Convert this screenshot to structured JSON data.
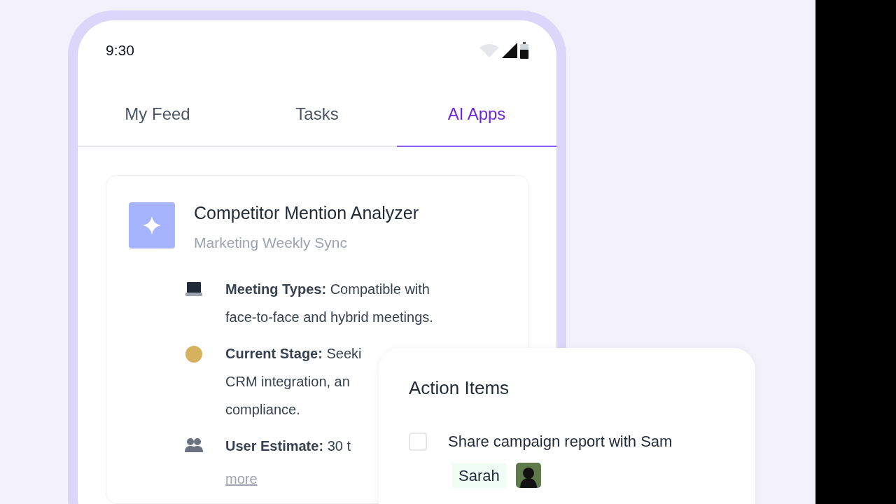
{
  "status_bar": {
    "time": "9:30"
  },
  "tabs": [
    {
      "label": "My Feed",
      "selected": false
    },
    {
      "label": "Tasks",
      "selected": false
    },
    {
      "label": "AI Apps",
      "selected": true
    }
  ],
  "app_card": {
    "title": "Competitor Mention Analyzer",
    "subtitle": "Marketing Weekly Sync",
    "details": [
      {
        "kind": "laptop",
        "label": "Meeting Types:",
        "lines": [
          "Compatible with",
          "face-to-face and hybrid meetings."
        ]
      },
      {
        "kind": "emoji",
        "label": "Current Stage:",
        "lines": [
          "Seeki",
          "CRM integration, an",
          "compliance."
        ]
      },
      {
        "kind": "users",
        "label": "User Estimate:",
        "lines": [
          "30 t"
        ]
      }
    ],
    "more_link": "more"
  },
  "action_items": {
    "title": "Action Items",
    "items": [
      {
        "text": "Share campaign report with Sam",
        "checked": false,
        "assignee": "Sarah"
      }
    ]
  }
}
